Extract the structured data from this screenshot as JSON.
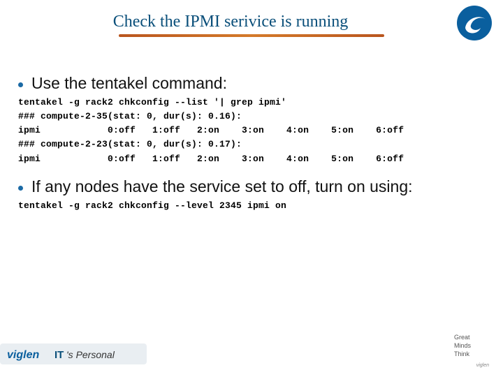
{
  "title": "Check the IPMI serivice is running",
  "bullets": {
    "b1": "Use the tentakel command:",
    "b2": "If any nodes have the service set to off, turn on using:"
  },
  "code": {
    "cmd1_l1": "tentakel -g rack2 chkconfig --list '| grep ipmi'",
    "cmd1_l2": "### compute-2-35(stat: 0, dur(s): 0.16):",
    "cmd1_l3": "ipmi            0:off   1:off   2:on    3:on    4:on    5:on    6:off",
    "cmd1_l4": "### compute-2-23(stat: 0, dur(s): 0.17):",
    "cmd1_l5": "ipmi            0:off   1:off   2:on    3:on    4:on    5:on    6:off",
    "cmd2_l1": "tentakel -g rack2 chkconfig --level 2345 ipmi on"
  },
  "footer": {
    "tag_it": "IT",
    "tag_personal": "'s Personal",
    "r1": "Great",
    "r2": "Minds",
    "r3": "Think",
    "brand_small": "viglen"
  }
}
